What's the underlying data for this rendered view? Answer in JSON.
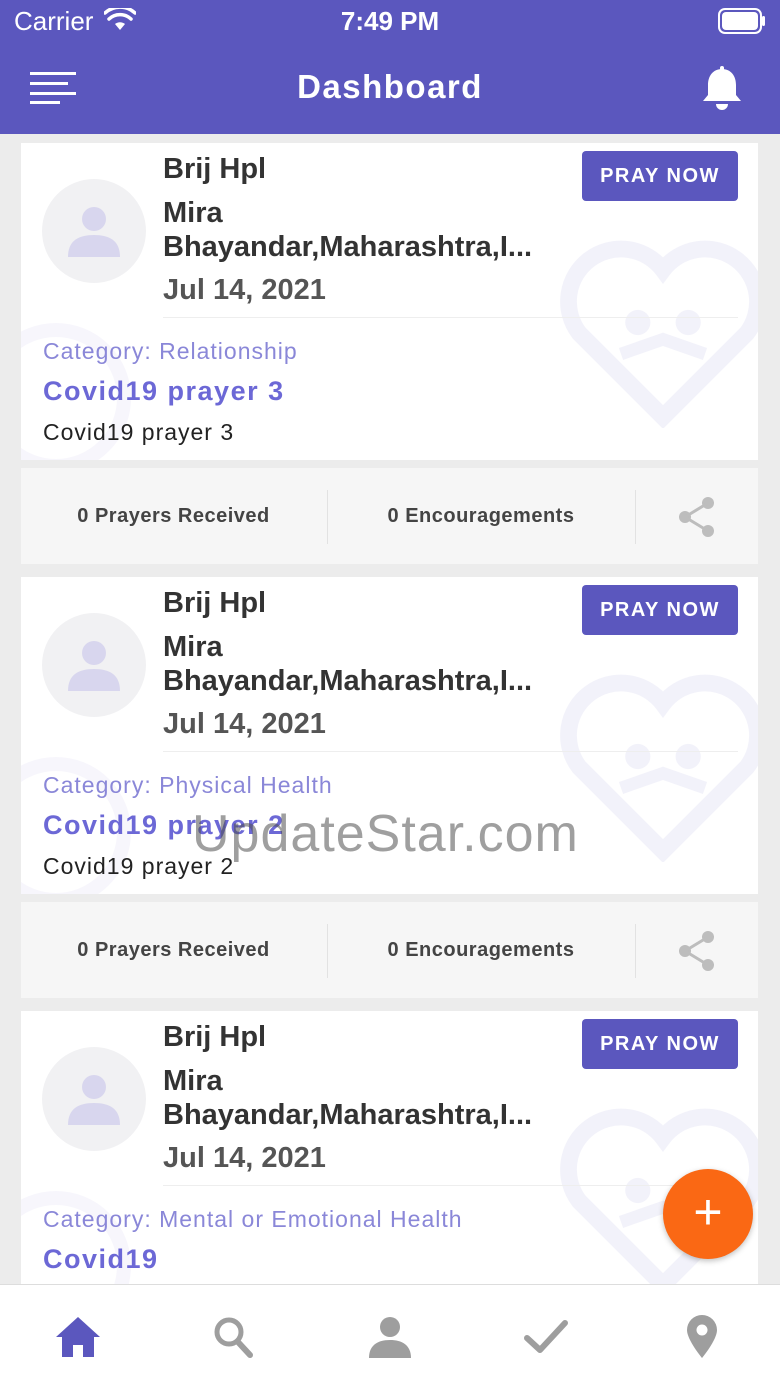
{
  "status_bar": {
    "carrier": "Carrier",
    "time": "7:49 PM"
  },
  "header": {
    "title": "Dashboard",
    "menu_icon": "menu-icon",
    "bell_icon": "bell-icon"
  },
  "posts": [
    {
      "name": "Brij Hpl",
      "location": "Mira Bhayandar,Maharashtra,I...",
      "date": "Jul 14, 2021",
      "pray_label": "PRAY NOW",
      "category_label": "Category:",
      "category": "Relationship",
      "title": "Covid19 prayer 3",
      "body": "Covid19 prayer 3",
      "prayers": "0 Prayers Received",
      "encouragements": "0 Encouragements"
    },
    {
      "name": "Brij Hpl",
      "location": "Mira Bhayandar,Maharashtra,I...",
      "date": "Jul 14, 2021",
      "pray_label": "PRAY NOW",
      "category_label": "Category:",
      "category": "Physical Health",
      "title": "Covid19 prayer 2",
      "body": "Covid19 prayer 2",
      "prayers": "0 Prayers Received",
      "encouragements": "0 Encouragements"
    },
    {
      "name": "Brij Hpl",
      "location": "Mira Bhayandar,Maharashtra,I...",
      "date": "Jul 14, 2021",
      "pray_label": "PRAY NOW",
      "category_label": "Category:",
      "category": "Mental or Emotional Health",
      "title": "Covid19",
      "body": "",
      "prayers": "",
      "encouragements": ""
    }
  ],
  "watermark": "UpdateStar.com",
  "fab": {
    "label": "+",
    "icon": "plus-icon"
  },
  "tabs": [
    {
      "icon": "home-icon",
      "active": true
    },
    {
      "icon": "search-icon",
      "active": false
    },
    {
      "icon": "profile-icon",
      "active": false
    },
    {
      "icon": "check-icon",
      "active": false
    },
    {
      "icon": "location-pin-icon",
      "active": false
    }
  ],
  "colors": {
    "primary": "#5b57be",
    "accent": "#fa6814",
    "category": "#8a87d8",
    "title": "#6c68d6"
  }
}
